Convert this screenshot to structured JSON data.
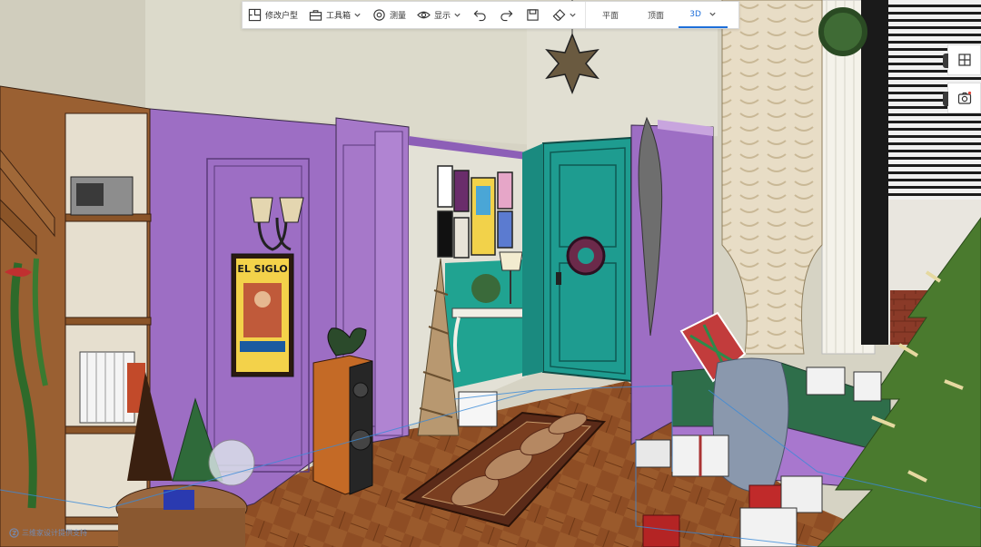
{
  "toolbar": {
    "edit_floorplan": "修改户型",
    "toolbox": "工具箱",
    "measure": "测量",
    "display": "显示",
    "views": {
      "plan": "平面",
      "top": "顶面",
      "threed": "3D"
    }
  },
  "poster_text": "EL SIGLO",
  "watermark_text": "三维家设计提供支持",
  "colors": {
    "accent": "#1e6fd9",
    "wall_purple": "#9a6bc1",
    "door_teal": "#1e9c90",
    "floor_wood": "#8a4a22",
    "upper_wall": "#d9d7c8"
  }
}
